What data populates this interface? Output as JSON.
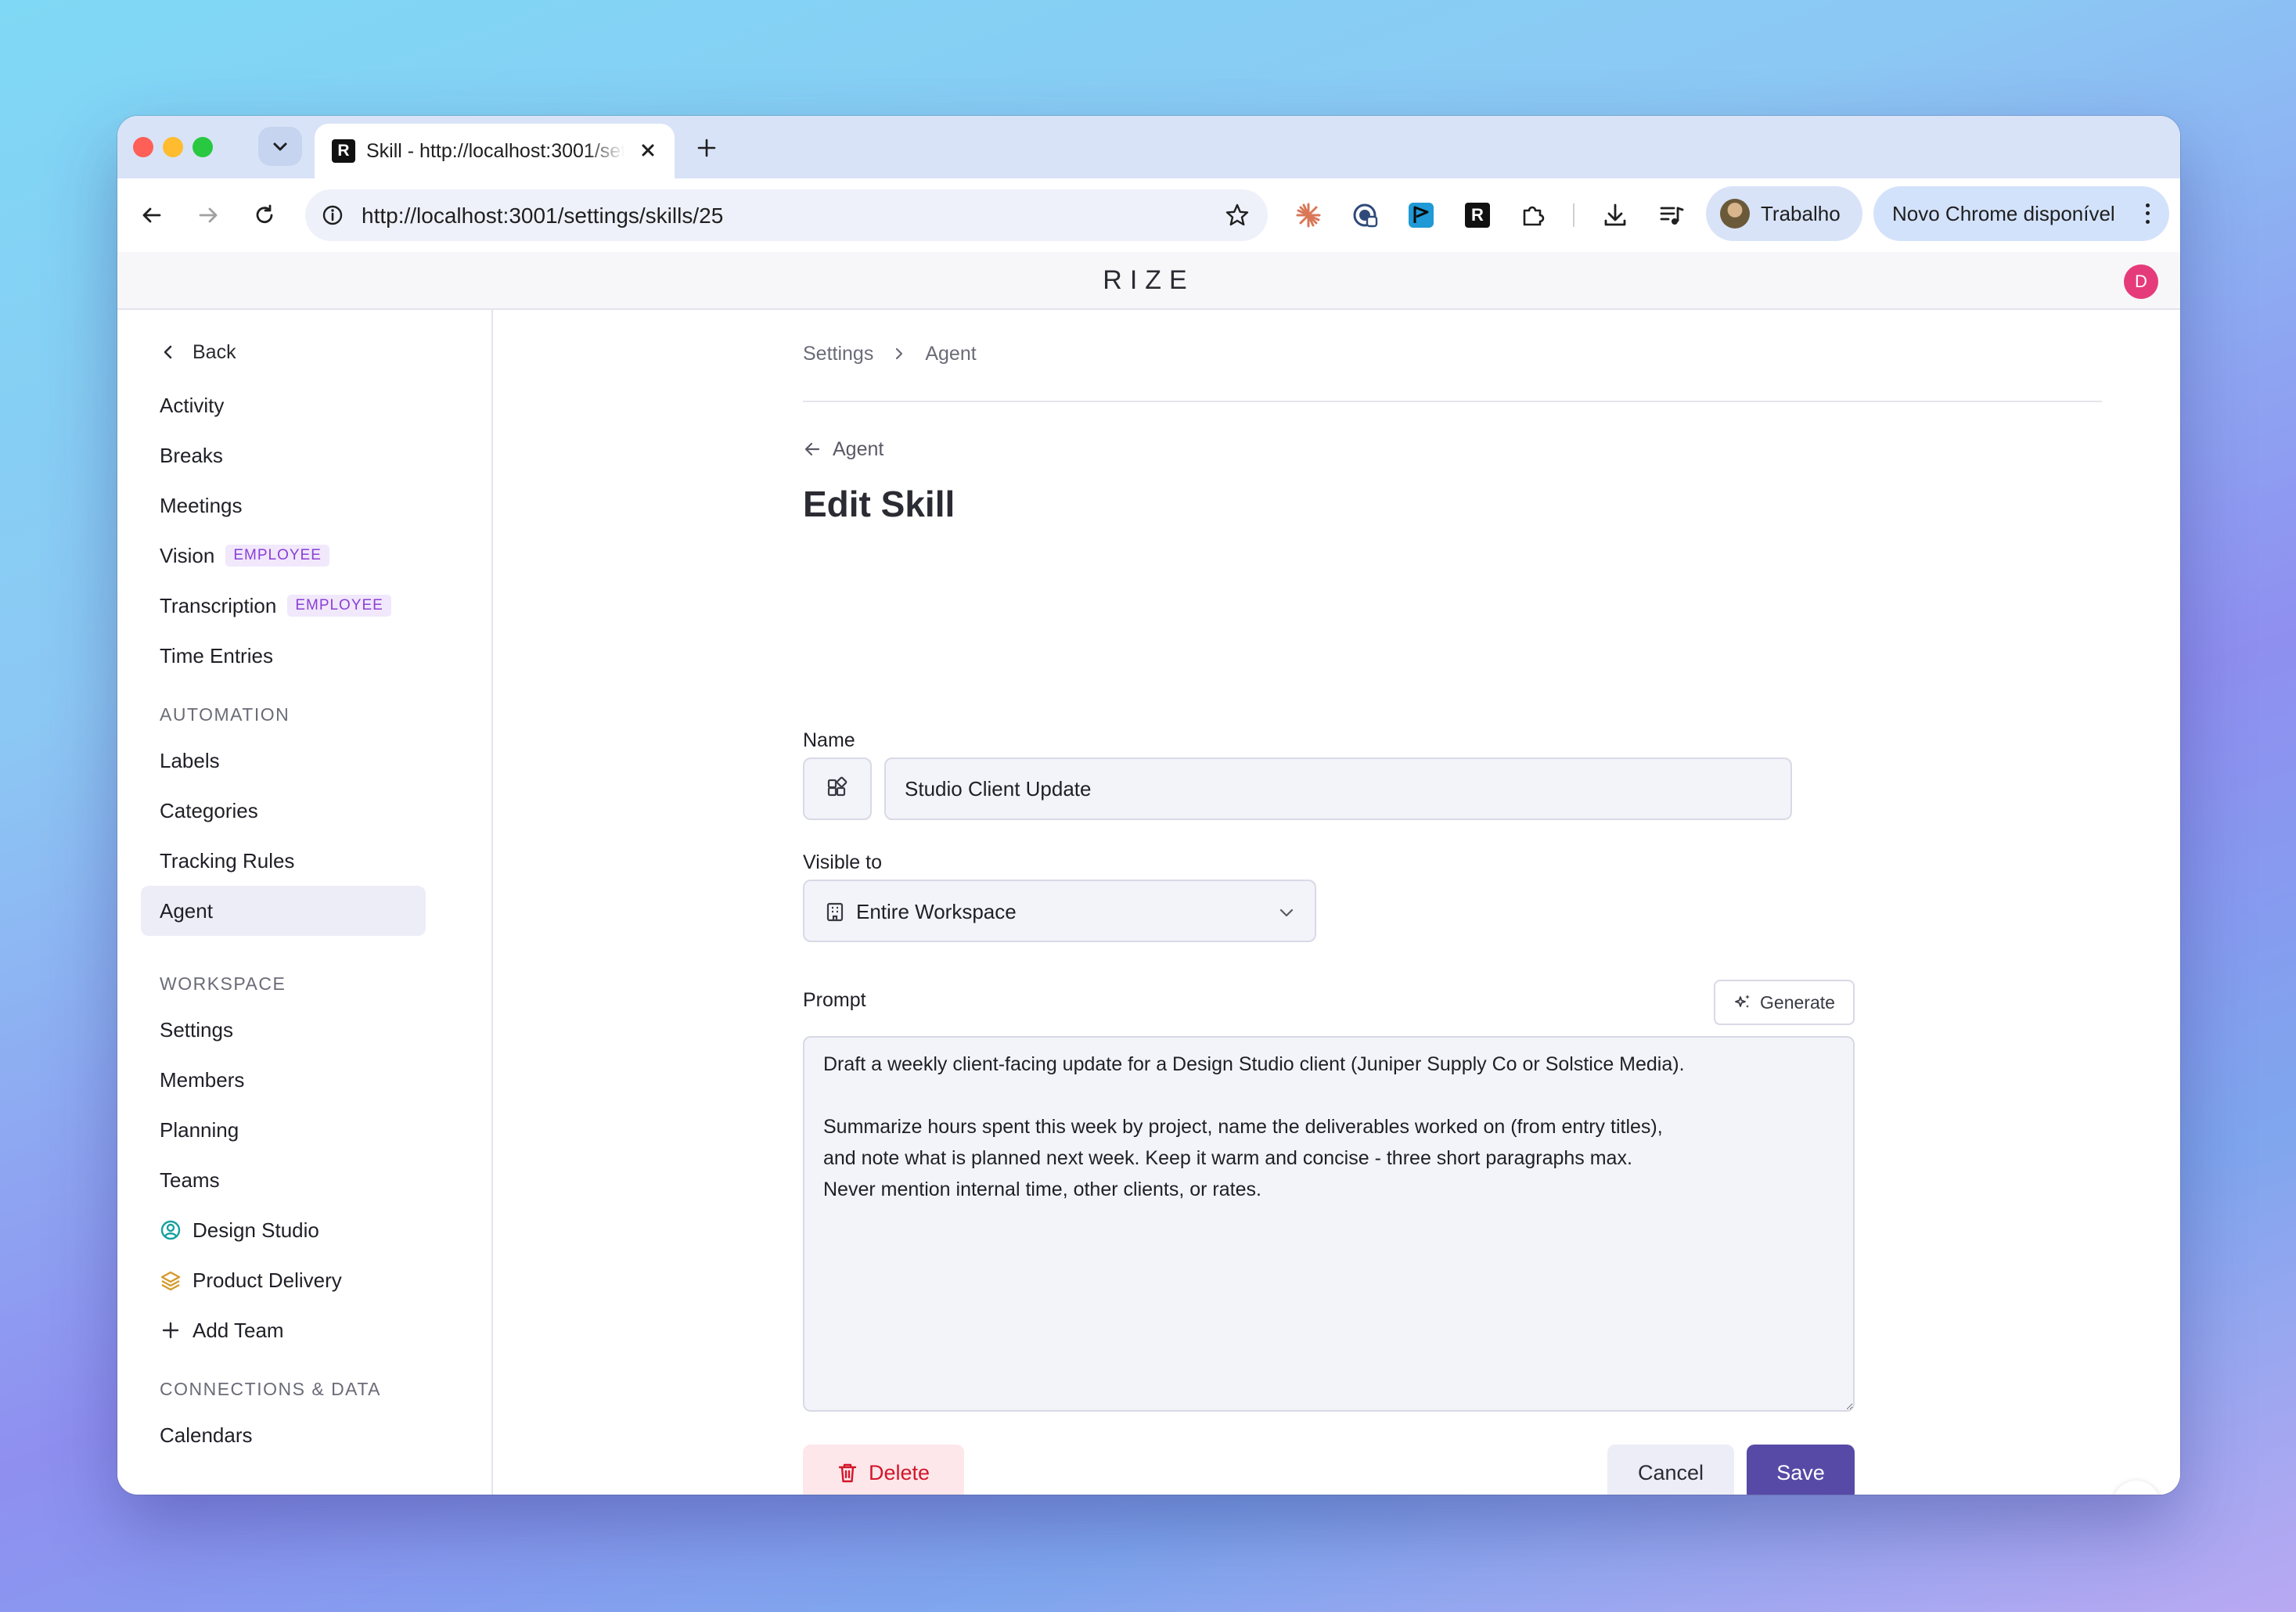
{
  "browser": {
    "tab": {
      "title": "Skill - http://localhost:3001/settings/skills/25",
      "favicon_letter": "R"
    },
    "address_bar": {
      "url": "http://localhost:3001/settings/skills/25"
    },
    "extensions": {
      "rize_letter": "R"
    },
    "profile": {
      "name": "Trabalho"
    },
    "update_chip": {
      "label": "Novo Chrome disponível"
    }
  },
  "app": {
    "logo": "RIZE",
    "user_avatar_letter": "D"
  },
  "sidebar": {
    "back_label": "Back",
    "items_top": [
      {
        "label": "Activity"
      },
      {
        "label": "Breaks"
      },
      {
        "label": "Meetings"
      },
      {
        "label": "Vision",
        "badge": "EMPLOYEE"
      },
      {
        "label": "Transcription",
        "badge": "EMPLOYEE"
      },
      {
        "label": "Time Entries"
      }
    ],
    "automation": {
      "heading": "AUTOMATION",
      "items": [
        {
          "label": "Labels"
        },
        {
          "label": "Categories"
        },
        {
          "label": "Tracking Rules"
        },
        {
          "label": "Agent",
          "active": true
        }
      ]
    },
    "workspace": {
      "heading": "WORKSPACE",
      "items": [
        {
          "label": "Settings"
        },
        {
          "label": "Members"
        },
        {
          "label": "Planning"
        },
        {
          "label": "Teams"
        },
        {
          "label": "Design Studio",
          "icon": "user-circle-icon"
        },
        {
          "label": "Product Delivery",
          "icon": "layers-icon"
        },
        {
          "label": "Add Team",
          "icon": "plus-icon"
        }
      ]
    },
    "connections": {
      "heading": "CONNECTIONS & DATA",
      "items": [
        {
          "label": "Calendars"
        }
      ]
    }
  },
  "main": {
    "breadcrumb": [
      "Settings",
      "Agent"
    ],
    "back_link": "Agent",
    "title": "Edit Skill",
    "name_field": {
      "label": "Name",
      "value": "Studio Client Update"
    },
    "visibility": {
      "label": "Visible to",
      "value": "Entire Workspace"
    },
    "prompt": {
      "label": "Prompt",
      "generate_label": "Generate",
      "value": "Draft a weekly client-facing update for a Design Studio client (Juniper Supply Co or Solstice Media).\n\nSummarize hours spent this week by project, name the deliverables worked on (from entry titles),\nand note what is planned next week. Keep it warm and concise - three short paragraphs max.\nNever mention internal time, other clients, or rates."
    },
    "actions": {
      "delete": "Delete",
      "cancel": "Cancel",
      "save": "Save"
    }
  },
  "colors": {
    "accent": "#574aa6",
    "badge_text": "#8a3fd6",
    "badge_bg": "#f1e8fc",
    "delete_text": "#d3162a",
    "delete_bg": "#fde7ea",
    "avatar": "#e63b7a"
  }
}
